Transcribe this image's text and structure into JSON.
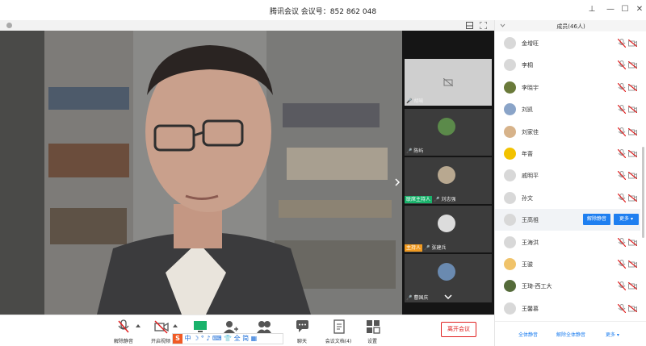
{
  "window": {
    "title": "腾讯会议  会议号：852 862 048"
  },
  "thumbnails": [
    {
      "name": "胡喻",
      "tag": ""
    },
    {
      "name": "陈屿",
      "tag": ""
    },
    {
      "name": "刘志强",
      "tag": "联席主持人"
    },
    {
      "name": "张建兵",
      "tag": "主持人"
    },
    {
      "name": "曹国庆",
      "tag": ""
    }
  ],
  "panel": {
    "title": "成员(46人)",
    "members": [
      {
        "name": "金增旺"
      },
      {
        "name": "李桐"
      },
      {
        "name": "李晓宇"
      },
      {
        "name": "刘凯"
      },
      {
        "name": "刘家佳"
      },
      {
        "name": "年蔷"
      },
      {
        "name": "戚明平"
      },
      {
        "name": "孙文"
      },
      {
        "name": "王高祖",
        "unmute": "解除静音",
        "more": "更多"
      },
      {
        "name": "王海洪"
      },
      {
        "name": "王骏"
      },
      {
        "name": "王琦-西工大"
      },
      {
        "name": "王馨慕"
      }
    ],
    "footer": {
      "mute_all": "全体静音",
      "unmute_all": "解除全体静音",
      "more": "更多"
    }
  },
  "toolbar": {
    "unmute": "解除静音",
    "start_video": "开启视频",
    "chat": "聊天",
    "docs": "会议文档(4)",
    "settings": "设置",
    "leave": "离开会议"
  },
  "ime": {
    "text": "中 ☽ ° ♪ ⌨ 👕 全 简 ▦"
  },
  "colors": {
    "accent": "#1f7ff0",
    "danger": "#e02020",
    "green": "#19b26b",
    "orange": "#f09a21"
  }
}
